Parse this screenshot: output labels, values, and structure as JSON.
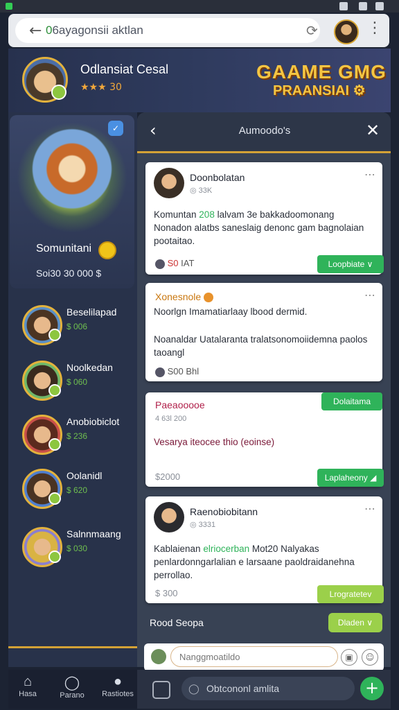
{
  "browser": {
    "url_prefix": "0",
    "url": "6ayagonsii aktlan"
  },
  "banner": {
    "title": "Odlansiat Cesal",
    "stars": "★★★ 30",
    "logo_line1": "GAAME GMG",
    "logo_line2": "PRAANSIAI ⚙"
  },
  "hero": {
    "name": "Somunitani",
    "stat": "Soi30   30   000 $"
  },
  "friends": [
    {
      "name": "Beselilapad",
      "points": "$ 006"
    },
    {
      "name": "Noolkedan",
      "points": "$ 060"
    },
    {
      "name": "Anobiobiclot",
      "points": "$ 236"
    },
    {
      "name": "Oolanidl",
      "points": "$ 620"
    },
    {
      "name": "Salnnmaang",
      "points": "$ 030"
    }
  ],
  "nav": [
    {
      "label": "Hasa",
      "icon": "home-icon"
    },
    {
      "label": "Parano",
      "icon": "search-icon"
    },
    {
      "label": "Rastiotes",
      "icon": "profile-icon"
    }
  ],
  "chat": {
    "title": "Aumoodo's",
    "posts": [
      {
        "user": "Doonbolatan",
        "sub": "◎ 33K",
        "body_a": "Komuntan ",
        "body_hl": "208",
        "body_b": " lalvam 3e bakkadoomonang Nonadon alatbs saneslaig denonc gam bagnolaian pootaitao.",
        "foot_red": "S0",
        "foot": "IAT",
        "button": "Loopbiate ∨"
      },
      {
        "title": "Xonesnole",
        "line1": "Noorlgn Imamatiarlaay lbood dermid.",
        "body": "Noanaldar  Uatalaranta tralatsonomoiidemna paolos taoangl",
        "foot": "S00  Bhl"
      },
      {
        "title": "Paeaooooe",
        "sub": "4 63l 200",
        "body": "Vesarya iteocee thio      (eoinse)",
        "foot": "$2000",
        "button_top": "Dolaitama",
        "button": "Laplaheony ◢"
      },
      {
        "user": "Raenobiobitann",
        "sub": "◎ 3331",
        "body_a": "Kablaienan ",
        "body_hl": "elriocerban",
        "body_b": " Mot20 Nalyakas penlardonngarlalian e larsaane paoldraidanehna perrollao.",
        "foot": "$ 300",
        "button": "Lrogratetev"
      }
    ],
    "reply_label": "Rood Seopa",
    "reply_button": "Dladen ∨",
    "input_placeholder": "Nanggmoatildo",
    "bottom_input": "Obtcononl amlita"
  }
}
